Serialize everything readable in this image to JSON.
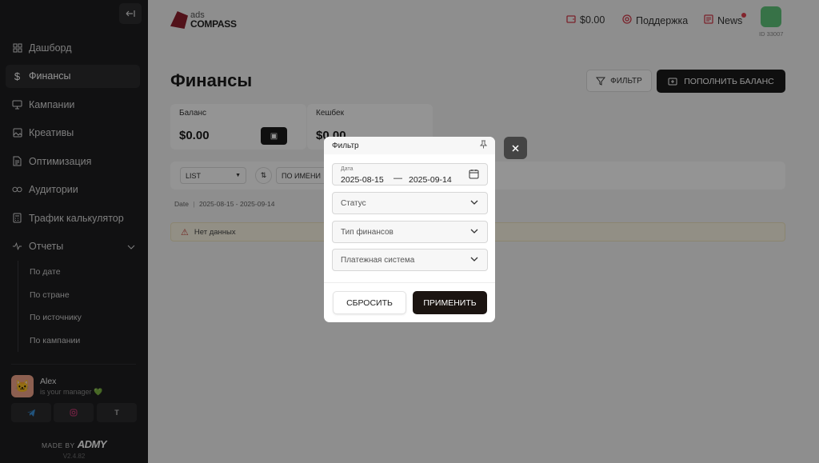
{
  "sidebar": {
    "collapse_icon": "collapse-icon",
    "items": [
      {
        "label": "Дашборд",
        "icon": "grid-icon"
      },
      {
        "label": "Финансы",
        "icon": "dollar-icon"
      },
      {
        "label": "Кампании",
        "icon": "monitor-icon"
      },
      {
        "label": "Креативы",
        "icon": "image-icon"
      },
      {
        "label": "Оптимизация",
        "icon": "document-icon"
      },
      {
        "label": "Аудитории",
        "icon": "link-icon"
      },
      {
        "label": "Трафик калькулятор",
        "icon": "calculator-icon"
      },
      {
        "label": "Отчеты",
        "icon": "activity-icon"
      }
    ],
    "reports_sub": [
      "По дате",
      "По стране",
      "По источнику",
      "По кампании"
    ],
    "manager": {
      "name": "Alex",
      "subtitle": "is your manager 💚"
    },
    "socials": [
      "telegram",
      "instagram",
      "T"
    ],
    "made_by": "MADE BY",
    "brand": "ADMY",
    "version": "V2.4.82"
  },
  "header": {
    "logo_small": "ads",
    "logo_big": "COMPASS",
    "balance": "$0.00",
    "support": "Поддержка",
    "news": "News",
    "user_id": "ID 33007"
  },
  "main": {
    "title": "Финансы",
    "filter_button": "ФИЛЬТР",
    "topup_button": "ПОПОЛНИТЬ БАЛАНС",
    "cards": [
      {
        "label": "Баланс",
        "value": "$0.00"
      },
      {
        "label": "Кешбек",
        "value": "$0.00"
      }
    ],
    "toolbar": {
      "view": "LIST",
      "sort": "ПО ИМЕНИ"
    },
    "date_label": "Date",
    "date_range": "2025-08-15 - 2025-09-14",
    "no_data": "Нет данных"
  },
  "modal": {
    "title": "Фильтр",
    "date_label": "Дата",
    "date_from": "2025-08-15",
    "date_sep": "—",
    "date_to": "2025-09-14",
    "status_placeholder": "Статус",
    "finance_type_placeholder": "Тип финансов",
    "payment_system_placeholder": "Платежная система",
    "reset": "СБРОСИТЬ",
    "apply": "ПРИМЕНИТЬ"
  },
  "colors": {
    "accent": "#d33b4a",
    "sidebar_bg": "#1e1e20",
    "dark_button": "#1b1b1b"
  }
}
